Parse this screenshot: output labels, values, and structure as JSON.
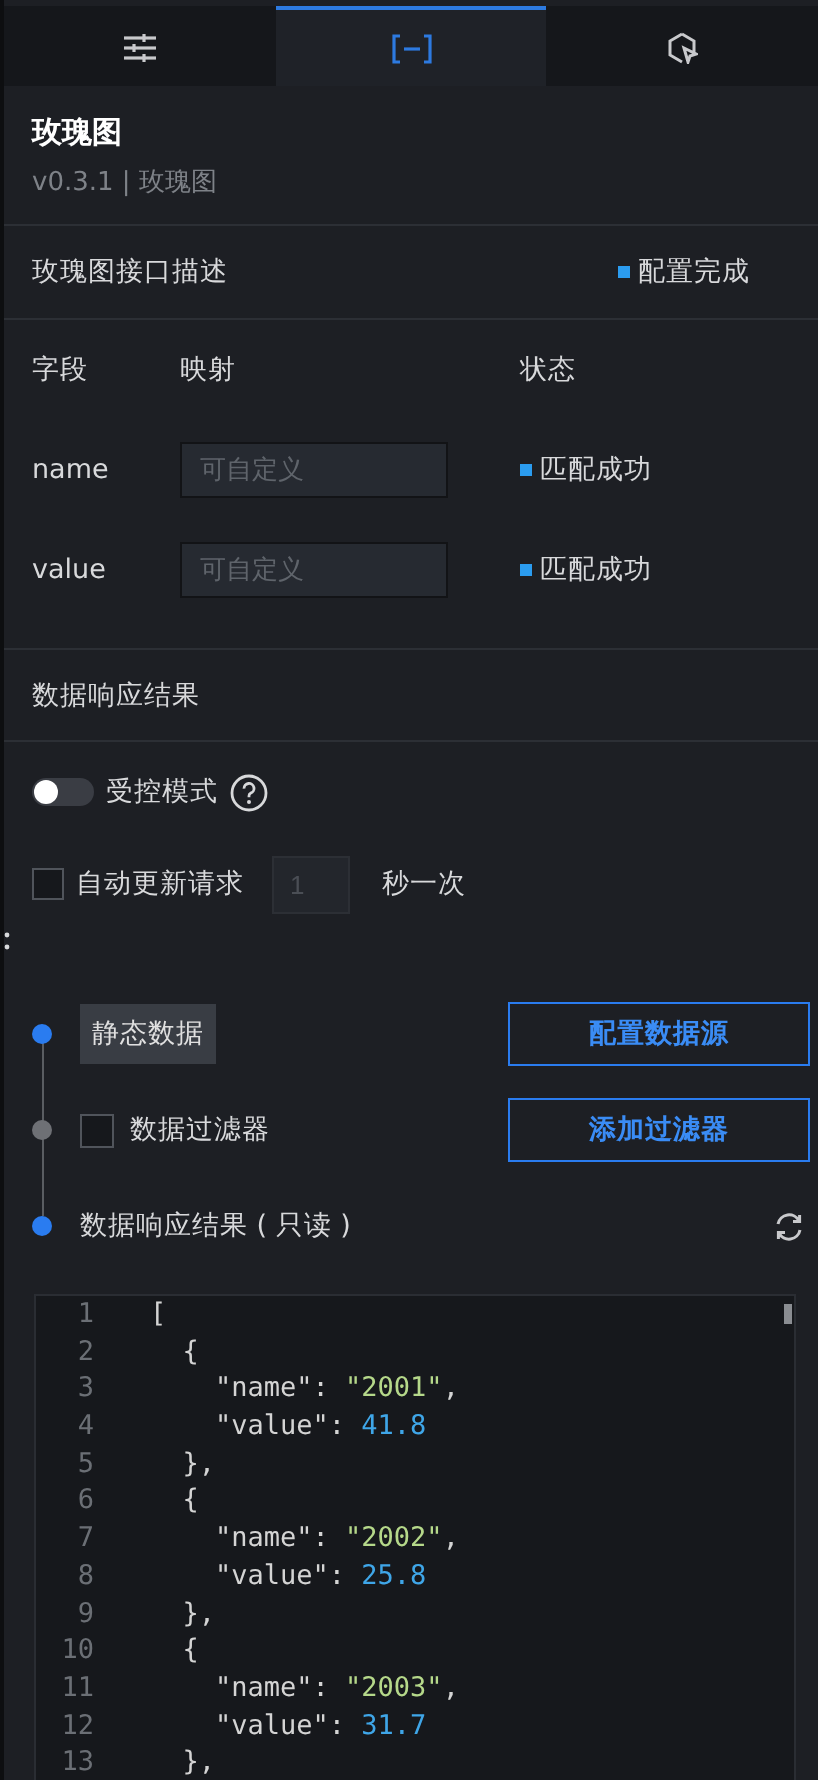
{
  "tabs": [
    {
      "kind": "sliders",
      "selected": false
    },
    {
      "kind": "brackets",
      "selected": true
    },
    {
      "kind": "cursor",
      "selected": false
    }
  ],
  "component": {
    "title": "玫瑰图",
    "version": "v0.3.1 | 玫瑰图"
  },
  "interface": {
    "title": "玫瑰图接口描述",
    "status": "配置完成"
  },
  "fields": {
    "columns": [
      "字段",
      "映射",
      "状态"
    ],
    "rows": [
      {
        "field": "name",
        "placeholder": "可自定义",
        "status": "匹配成功"
      },
      {
        "field": "value",
        "placeholder": "可自定义",
        "status": "匹配成功"
      }
    ]
  },
  "response": {
    "title": "数据响应结果",
    "controlled": {
      "label": "受控模式",
      "on": false
    },
    "auto_update": {
      "label": "自动更新请求",
      "checked": false,
      "interval_placeholder": "1",
      "unit": "秒一次"
    }
  },
  "pipeline": [
    {
      "kind": "source",
      "active": true,
      "tag": "静态数据",
      "button": "配置数据源"
    },
    {
      "kind": "filter",
      "active": false,
      "checked": false,
      "label": "数据过滤器",
      "button": "添加过滤器"
    },
    {
      "kind": "result",
      "active": true,
      "label": "数据响应结果 ( 只读 )"
    }
  ],
  "code": {
    "lines": [
      {
        "number": "1",
        "tokens": [
          {
            "kind": "punct",
            "text": "["
          }
        ]
      },
      {
        "number": "2",
        "tokens": [
          {
            "kind": "punct",
            "text": "  {"
          }
        ]
      },
      {
        "number": "3",
        "tokens": [
          {
            "kind": "key",
            "text": "    \"name\""
          },
          {
            "kind": "punct",
            "text": ": "
          },
          {
            "kind": "string",
            "text": "\"2001\""
          },
          {
            "kind": "punct",
            "text": ","
          }
        ]
      },
      {
        "number": "4",
        "tokens": [
          {
            "kind": "key",
            "text": "    \"value\""
          },
          {
            "kind": "punct",
            "text": ": "
          },
          {
            "kind": "number",
            "text": "41.8"
          }
        ]
      },
      {
        "number": "5",
        "tokens": [
          {
            "kind": "punct",
            "text": "  },"
          }
        ]
      },
      {
        "number": "6",
        "tokens": [
          {
            "kind": "punct",
            "text": "  {"
          }
        ]
      },
      {
        "number": "7",
        "tokens": [
          {
            "kind": "key",
            "text": "    \"name\""
          },
          {
            "kind": "punct",
            "text": ": "
          },
          {
            "kind": "string",
            "text": "\"2002\""
          },
          {
            "kind": "punct",
            "text": ","
          }
        ]
      },
      {
        "number": "8",
        "tokens": [
          {
            "kind": "key",
            "text": "    \"value\""
          },
          {
            "kind": "punct",
            "text": ": "
          },
          {
            "kind": "number",
            "text": "25.8"
          }
        ]
      },
      {
        "number": "9",
        "tokens": [
          {
            "kind": "punct",
            "text": "  },"
          }
        ]
      },
      {
        "number": "10",
        "tokens": [
          {
            "kind": "punct",
            "text": "  {"
          }
        ]
      },
      {
        "number": "11",
        "tokens": [
          {
            "kind": "key",
            "text": "    \"name\""
          },
          {
            "kind": "punct",
            "text": ": "
          },
          {
            "kind": "string",
            "text": "\"2003\""
          },
          {
            "kind": "punct",
            "text": ","
          }
        ]
      },
      {
        "number": "12",
        "tokens": [
          {
            "kind": "key",
            "text": "    \"value\""
          },
          {
            "kind": "punct",
            "text": ": "
          },
          {
            "kind": "number",
            "text": "31.7"
          }
        ]
      },
      {
        "number": "13",
        "tokens": [
          {
            "kind": "punct",
            "text": "  },"
          }
        ]
      }
    ]
  }
}
